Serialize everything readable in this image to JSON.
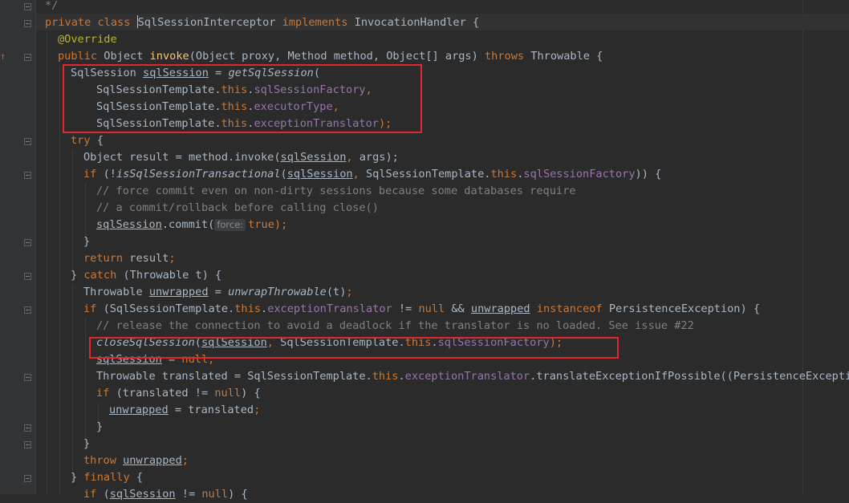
{
  "editor": {
    "lines": [
      [
        {
          "t": "*/",
          "c": "cm"
        }
      ],
      [
        {
          "t": "private class ",
          "c": "kw"
        },
        {
          "t": "",
          "c": "caret"
        },
        {
          "t": "SqlSessionInterceptor",
          "c": "hl"
        },
        {
          "t": " implements ",
          "c": "kw"
        },
        {
          "t": "InvocationHandler {"
        }
      ],
      [
        {
          "t": "@Override",
          "c": "ann"
        }
      ],
      [
        {
          "t": "public ",
          "c": "kw"
        },
        {
          "t": "Object "
        },
        {
          "t": "invoke",
          "c": "fn"
        },
        {
          "t": "(Object proxy, Method method, Object[] args) "
        },
        {
          "t": "throws ",
          "c": "kw"
        },
        {
          "t": "Throwable {"
        }
      ],
      [
        {
          "t": "SqlSession "
        },
        {
          "t": "sqlSession",
          "c": "ul"
        },
        {
          "t": " = "
        },
        {
          "t": "getSqlSession",
          "c": "it"
        },
        {
          "t": "("
        }
      ],
      [
        {
          "t": "SqlSessionTemplate."
        },
        {
          "t": "this",
          "c": "kw"
        },
        {
          "t": "."
        },
        {
          "t": "sqlSessionFactory",
          "c": "fld"
        },
        {
          "t": ",",
          "c": "kw"
        }
      ],
      [
        {
          "t": "SqlSessionTemplate."
        },
        {
          "t": "this",
          "c": "kw"
        },
        {
          "t": "."
        },
        {
          "t": "executorType",
          "c": "fld"
        },
        {
          "t": ",",
          "c": "kw"
        }
      ],
      [
        {
          "t": "SqlSessionTemplate."
        },
        {
          "t": "this",
          "c": "kw"
        },
        {
          "t": "."
        },
        {
          "t": "exceptionTranslator",
          "c": "fld"
        },
        {
          "t": ");",
          "c": "kw"
        }
      ],
      [
        {
          "t": "try ",
          "c": "kw"
        },
        {
          "t": "{"
        }
      ],
      [
        {
          "t": "Object result = method.invoke("
        },
        {
          "t": "sqlSession",
          "c": "ul"
        },
        {
          "t": ", ",
          "c": "kw"
        },
        {
          "t": "args);"
        }
      ],
      [
        {
          "t": "if ",
          "c": "kw"
        },
        {
          "t": "(!"
        },
        {
          "t": "isSqlSessionTransactional",
          "c": "it"
        },
        {
          "t": "("
        },
        {
          "t": "sqlSession",
          "c": "ul"
        },
        {
          "t": ", ",
          "c": "kw"
        },
        {
          "t": "SqlSessionTemplate."
        },
        {
          "t": "this",
          "c": "kw"
        },
        {
          "t": "."
        },
        {
          "t": "sqlSessionFactory",
          "c": "fld"
        },
        {
          "t": ")) {"
        }
      ],
      [
        {
          "t": "// force commit even on non-dirty sessions because some databases require",
          "c": "cm"
        }
      ],
      [
        {
          "t": "// a commit/rollback before calling close()",
          "c": "cm"
        }
      ],
      [
        {
          "t": "sqlSession",
          "c": "ul"
        },
        {
          "t": ".commit("
        },
        {
          "t": "force:",
          "c": "hint"
        },
        {
          "t": "true",
          "c": "kw"
        },
        {
          "t": ");",
          "c": "kw"
        }
      ],
      [
        {
          "t": "}"
        }
      ],
      [
        {
          "t": "return ",
          "c": "kw"
        },
        {
          "t": "result"
        },
        {
          "t": ";",
          "c": "kw"
        }
      ],
      [
        {
          "t": "} "
        },
        {
          "t": "catch ",
          "c": "kw"
        },
        {
          "t": "(Throwable t) {"
        }
      ],
      [
        {
          "t": "Throwable "
        },
        {
          "t": "unwrapped",
          "c": "ul"
        },
        {
          "t": " = "
        },
        {
          "t": "unwrapThrowable",
          "c": "it"
        },
        {
          "t": "(t)"
        },
        {
          "t": ";",
          "c": "kw"
        }
      ],
      [
        {
          "t": "if ",
          "c": "kw"
        },
        {
          "t": "(SqlSessionTemplate."
        },
        {
          "t": "this",
          "c": "kw"
        },
        {
          "t": "."
        },
        {
          "t": "exceptionTranslator",
          "c": "fld"
        },
        {
          "t": " != "
        },
        {
          "t": "null ",
          "c": "kw"
        },
        {
          "t": "&& "
        },
        {
          "t": "unwrapped",
          "c": "ul"
        },
        {
          "t": " "
        },
        {
          "t": "instanceof ",
          "c": "kw"
        },
        {
          "t": "PersistenceException) {"
        }
      ],
      [
        {
          "t": "// release the connection to avoid a deadlock if the translator is no loaded. See issue #22",
          "c": "cm"
        }
      ],
      [
        {
          "t": "closeSqlSession",
          "c": "it"
        },
        {
          "t": "("
        },
        {
          "t": "sqlSession",
          "c": "ul"
        },
        {
          "t": ", ",
          "c": "kw"
        },
        {
          "t": "SqlSessionTemplate."
        },
        {
          "t": "this",
          "c": "kw"
        },
        {
          "t": "."
        },
        {
          "t": "sqlSessionFactory",
          "c": "fld"
        },
        {
          "t": ");",
          "c": "kw"
        }
      ],
      [
        {
          "t": "sqlSession",
          "c": "ul"
        },
        {
          "t": " = "
        },
        {
          "t": "null",
          "c": "kw"
        },
        {
          "t": ";",
          "c": "kw"
        }
      ],
      [
        {
          "t": "Throwable translated = SqlSessionTemplate."
        },
        {
          "t": "this",
          "c": "kw"
        },
        {
          "t": "."
        },
        {
          "t": "exceptionTranslator",
          "c": "fld"
        },
        {
          "t": ".translateExceptionIfPossible((PersistenceException"
        }
      ],
      [
        {
          "t": "if ",
          "c": "kw"
        },
        {
          "t": "(translated != "
        },
        {
          "t": "null",
          "c": "kw"
        },
        {
          "t": ") {"
        }
      ],
      [
        {
          "t": "unwrapped",
          "c": "ul"
        },
        {
          "t": " = translated"
        },
        {
          "t": ";",
          "c": "kw"
        }
      ],
      [
        {
          "t": "}"
        }
      ],
      [
        {
          "t": "}"
        }
      ],
      [
        {
          "t": "throw ",
          "c": "kw"
        },
        {
          "t": "unwrapped",
          "c": "ul"
        },
        {
          "t": ";",
          "c": "kw"
        }
      ],
      [
        {
          "t": "} "
        },
        {
          "t": "finally ",
          "c": "kw"
        },
        {
          "t": "{"
        }
      ],
      [
        {
          "t": "if ",
          "c": "kw"
        },
        {
          "t": "("
        },
        {
          "t": "sqlSession",
          "c": "ul"
        },
        {
          "t": " != "
        },
        {
          "t": "null",
          "c": "kw"
        },
        {
          "t": ") {"
        }
      ]
    ]
  },
  "icons": {
    "fold_marker": "fold-icon",
    "implements_marker": "implementing-method-icon"
  },
  "colors": {
    "background": "#2b2b2b",
    "highlight_box": "#e0262f",
    "keyword": "#cc7832",
    "field": "#9876aa",
    "comment": "#808080"
  }
}
